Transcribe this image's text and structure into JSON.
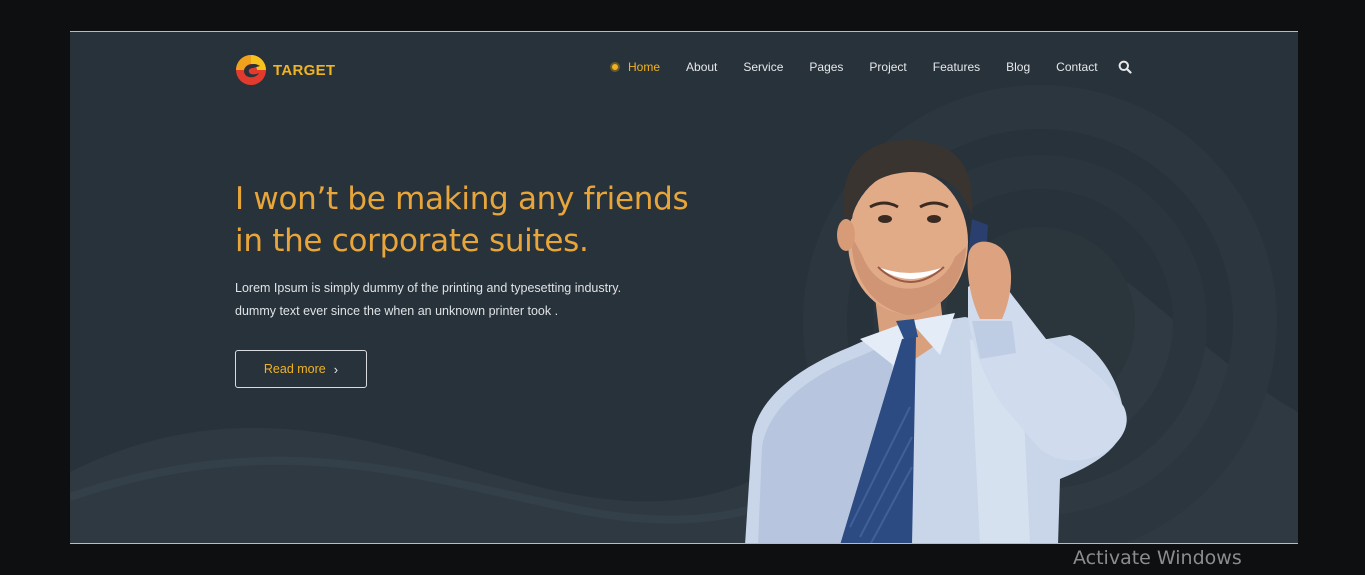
{
  "brand": {
    "name": "TARGET",
    "icon": "target-logo-icon"
  },
  "nav": {
    "items": [
      {
        "label": "Home",
        "active": true
      },
      {
        "label": "About",
        "active": false
      },
      {
        "label": "Service",
        "active": false
      },
      {
        "label": "Pages",
        "active": false
      },
      {
        "label": "Project",
        "active": false
      },
      {
        "label": "Features",
        "active": false
      },
      {
        "label": "Blog",
        "active": false
      },
      {
        "label": "Contact",
        "active": false
      }
    ],
    "search_icon": "search-icon"
  },
  "hero": {
    "title_line1": "I won’t be making any friends",
    "title_line2": "in the corporate suites.",
    "desc_line1": "Lorem Ipsum is simply dummy of the printing and typesetting industry.",
    "desc_line2": "dummy text ever since the when an unknown printer took  .",
    "button_label": "Read more",
    "button_icon": "chevron-right-icon"
  },
  "colors": {
    "accent": "#f0b323",
    "background": "#28323a",
    "text": "#e6e8ea"
  },
  "os_watermark": "Activate Windows"
}
